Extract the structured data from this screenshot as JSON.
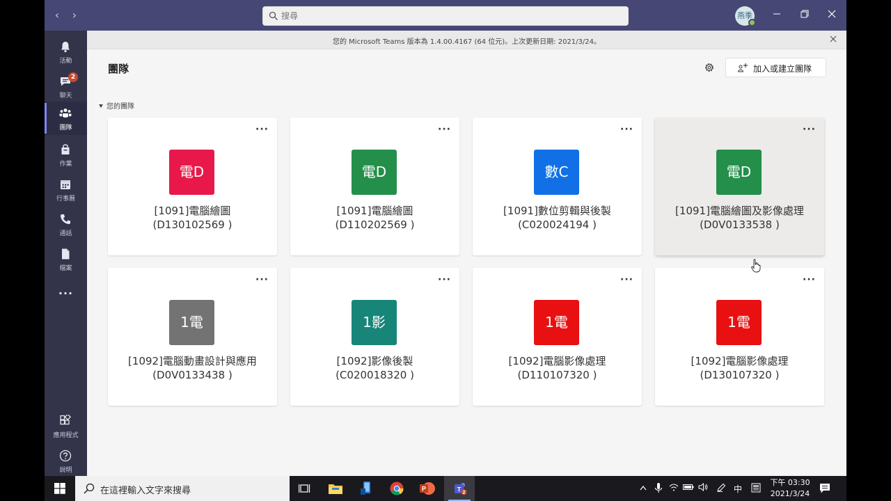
{
  "titlebar": {
    "search_placeholder": "搜尋",
    "avatar_initials": "燕季",
    "back": "‹",
    "forward": "›"
  },
  "banner": {
    "text": "您的 Microsoft Teams 版本為 1.4.00.4167 (64 位元)。上次更新日期: 2021/3/24。"
  },
  "rail": {
    "items": [
      {
        "label": "活動",
        "icon": "bell-icon"
      },
      {
        "label": "聊天",
        "icon": "chat-icon",
        "badge": "2"
      },
      {
        "label": "團隊",
        "icon": "teams-icon",
        "active": true
      },
      {
        "label": "作業",
        "icon": "assignments-icon"
      },
      {
        "label": "行事曆",
        "icon": "calendar-icon"
      },
      {
        "label": "通話",
        "icon": "phone-icon"
      },
      {
        "label": "檔案",
        "icon": "file-icon"
      }
    ],
    "more": "...",
    "apps_label": "應用程式",
    "help_label": "說明"
  },
  "main": {
    "title": "團隊",
    "join_button": "加入或建立團隊",
    "section_label": "您的團隊"
  },
  "teams": [
    {
      "tile": "電D",
      "color": "#e8194a",
      "name": "[1091]電腦繪圖",
      "code": "(D130102569 )"
    },
    {
      "tile": "電D",
      "color": "#238f4a",
      "name": "[1091]電腦繪圖",
      "code": "(D110202569 )"
    },
    {
      "tile": "數C",
      "color": "#1170e6",
      "name": "[1091]數位剪輯與後製",
      "code": "(C020024194 )"
    },
    {
      "tile": "電D",
      "color": "#238f4a",
      "name": "[1091]電腦繪圖及影像處理",
      "code": "(D0V0133538 )",
      "hover": true
    },
    {
      "tile": "1電",
      "color": "#737373",
      "name": "[1092]電腦動畫設計與應用",
      "code": "(D0V0133438 )"
    },
    {
      "tile": "1影",
      "color": "#188579",
      "name": "[1092]影像後製",
      "code": "(C020018320 )"
    },
    {
      "tile": "1電",
      "color": "#e81011",
      "name": "[1092]電腦影像處理",
      "code": "(D110107320 )"
    },
    {
      "tile": "1電",
      "color": "#e81011",
      "name": "[1092]電腦影像處理",
      "code": "(D130107320 )"
    }
  ],
  "taskbar": {
    "search_placeholder": "在這裡輸入文字來搜尋",
    "clock_time": "下午 03:30",
    "clock_date": "2021/3/24",
    "ime": "中"
  }
}
